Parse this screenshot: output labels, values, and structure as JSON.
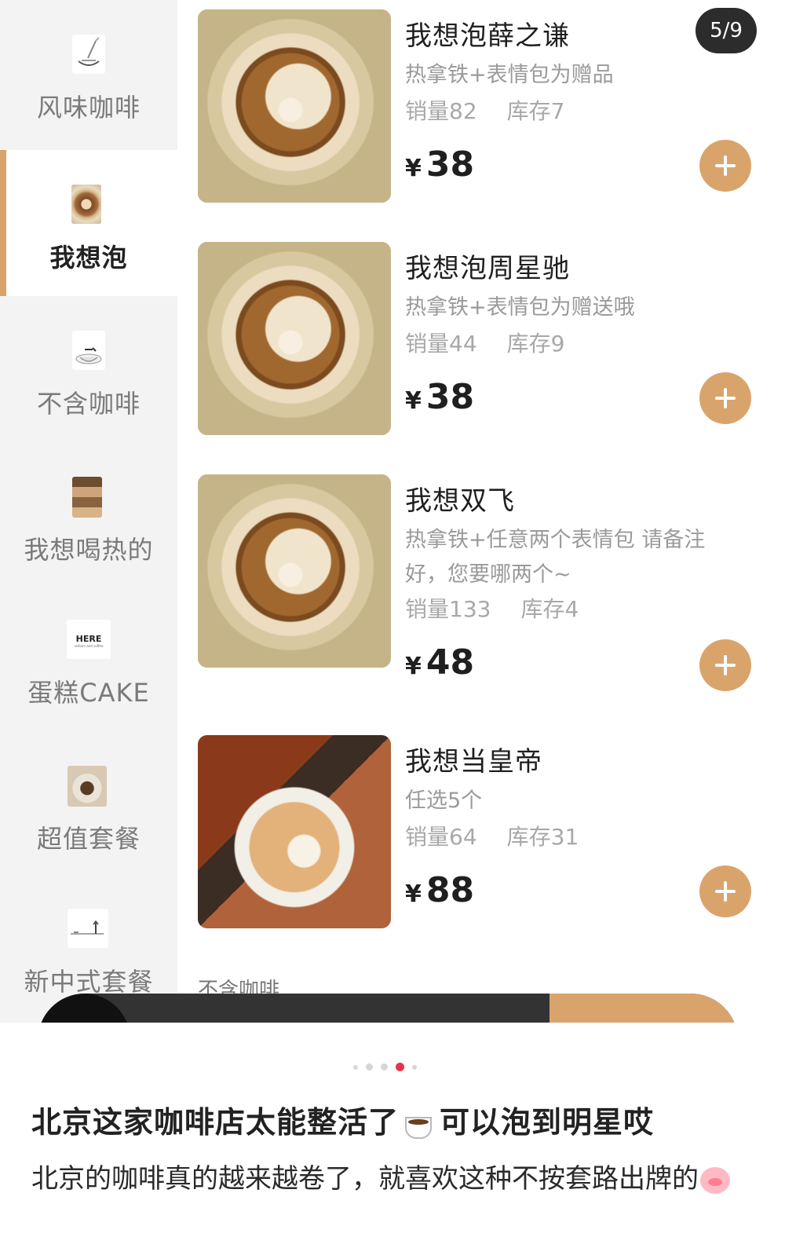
{
  "pager": {
    "text": "5/9"
  },
  "sidebar": {
    "items": [
      {
        "label": "风味咖啡",
        "thumb": "latte-art-line-icon",
        "active": false
      },
      {
        "label": "我想泡",
        "thumb": "latte-photo",
        "active": true
      },
      {
        "label": "不含咖啡",
        "thumb": "cup-drink-icon",
        "active": false
      },
      {
        "label": "我想喝热的",
        "thumb": "hot-drinks-photo",
        "active": false
      },
      {
        "label": "蛋糕CAKE",
        "thumb": "here-logo",
        "active": false,
        "logo_text": "HERE",
        "logo_subtext": "visitors and coffee"
      },
      {
        "label": "超值套餐",
        "thumb": "set-meal-photo",
        "active": false
      },
      {
        "label": "新中式套餐",
        "thumb": "sketch-line-icon",
        "active": false
      }
    ]
  },
  "products": [
    {
      "name": "我想泡薛之谦",
      "desc": "热拿铁+表情包为赠品",
      "sales": "销量82",
      "stock": "库存7",
      "currency": "¥",
      "price": "38"
    },
    {
      "name": "我想泡周星驰",
      "desc": "热拿铁+表情包为赠送哦",
      "sales": "销量44",
      "stock": "库存9",
      "currency": "¥",
      "price": "38"
    },
    {
      "name": "我想双飞",
      "desc": "热拿铁+任意两个表情包 请备注好，您要哪两个~",
      "sales": "销量133",
      "stock": "库存4",
      "currency": "¥",
      "price": "48"
    },
    {
      "name": "我想当皇帝",
      "desc": "任选5个",
      "sales": "销量64",
      "stock": "库存31",
      "currency": "¥",
      "price": "88"
    }
  ],
  "next_section": {
    "label": "不含咖啡"
  },
  "carousel": {
    "total": 5,
    "active_index": 3
  },
  "post": {
    "title_part1": "北京这家咖啡店太能整活了",
    "title_emoji": "hot-beverage-emoji",
    "title_part2": "可以泡到明星哎",
    "body": "北京的咖啡真的越来越卷了，就喜欢这种不按套路出牌的",
    "body_emoji": "pig-face-emoji"
  },
  "colors": {
    "accent": "#d9a46b",
    "sidebar_bg": "#f3f3f3",
    "cart_bar": "#333333",
    "pager_bg": "#2c2c2c",
    "carousel_active": "#e8344a"
  }
}
